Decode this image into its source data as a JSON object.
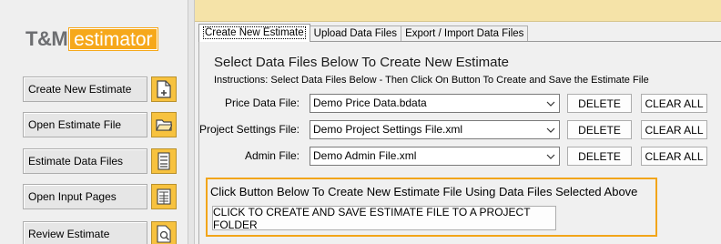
{
  "logo": {
    "brand": "T&M",
    "product": "estimator"
  },
  "sidebar": {
    "items": [
      {
        "label": "Create New Estimate",
        "icon": "new-document-icon"
      },
      {
        "label": "Open Estimate File",
        "icon": "folder-icon"
      },
      {
        "label": "Estimate Data Files",
        "icon": "data-list-icon"
      },
      {
        "label": "Open Input Pages",
        "icon": "form-page-icon"
      },
      {
        "label": "Review Estimate",
        "icon": "magnify-document-icon"
      }
    ]
  },
  "tabs": [
    {
      "label": "Create New Estimate",
      "active": true
    },
    {
      "label": "Upload Data Files",
      "active": false
    },
    {
      "label": "Export / Import Data Files",
      "active": false
    }
  ],
  "main": {
    "heading": "Select Data Files Below To Create New Estimate",
    "instructions": "Instructions:  Select Data Files Below - Then Click On Button To Create and Save the Estimate File",
    "fields": [
      {
        "label": "Price Data File:",
        "value": "Demo Price Data.bdata"
      },
      {
        "label": "Project Settings File:",
        "value": "Demo Project Settings File.xml"
      },
      {
        "label": "Admin File:",
        "value": "Demo Admin File.xml"
      }
    ],
    "delete_label": "DELETE",
    "clear_all_label": "CLEAR ALL",
    "create_prompt": "Click Button Below To Create New Estimate File Using Data Files Selected Above",
    "create_button": "CLICK TO CREATE AND SAVE ESTIMATE FILE TO A PROJECT FOLDER"
  },
  "colors": {
    "accent": "#f6a81b",
    "icon_bg": "#f7c23f",
    "topbar": "#f5e3a8",
    "highlight_border": "#f2a51a"
  }
}
